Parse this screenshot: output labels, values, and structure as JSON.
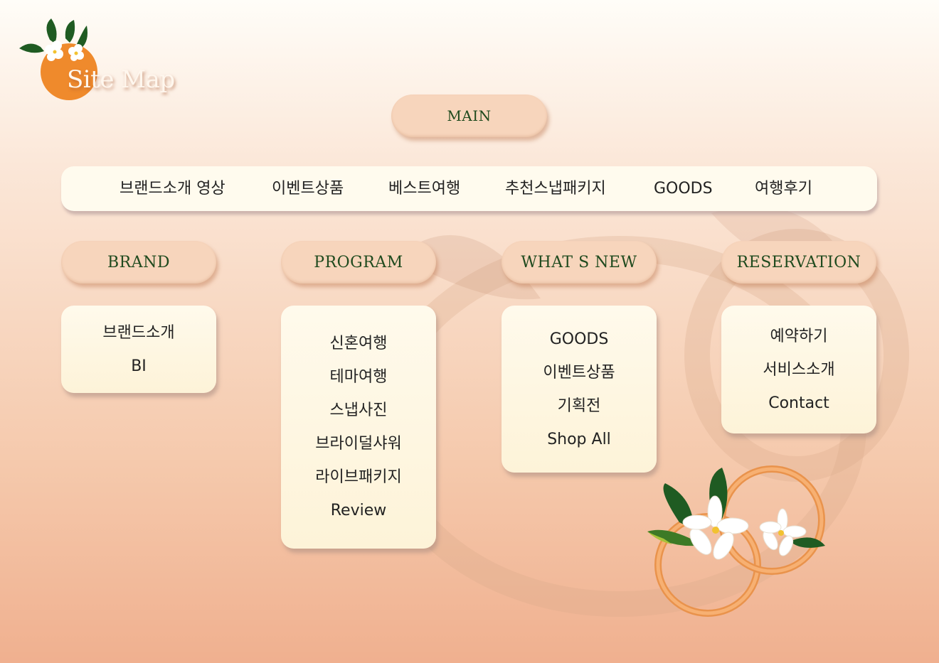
{
  "title": "Site Map",
  "main_label": "MAIN",
  "nav": [
    "브랜드소개 영상",
    "이벤트상품",
    "베스트여행",
    "추천스냅패키지",
    "GOODS",
    "여행후기"
  ],
  "sections": [
    {
      "label": "BRAND",
      "items": [
        "브랜드소개",
        "BI"
      ]
    },
    {
      "label": "PROGRAM",
      "items": [
        "신혼여행",
        "테마여행",
        "스냅사진",
        "브라이덜샤워",
        "라이브패키지",
        "Review"
      ]
    },
    {
      "label": "WHAT S NEW",
      "items": [
        "GOODS",
        "이벤트상품",
        "기획전",
        "Shop All"
      ]
    },
    {
      "label": "RESERVATION",
      "items": [
        "예약하기",
        "서비스소개",
        "Contact"
      ]
    }
  ],
  "colors": {
    "label_text": "#1f4a1e",
    "pill": "#f7d5bc",
    "card": "#fffaec",
    "accent_orange": "#ef8a2c",
    "ring": "#f0a060",
    "leaf": "#1f5b22"
  },
  "icons": [
    "orange-flower-logo-icon",
    "rings-flowers-icon",
    "watermark-ring-icon"
  ]
}
